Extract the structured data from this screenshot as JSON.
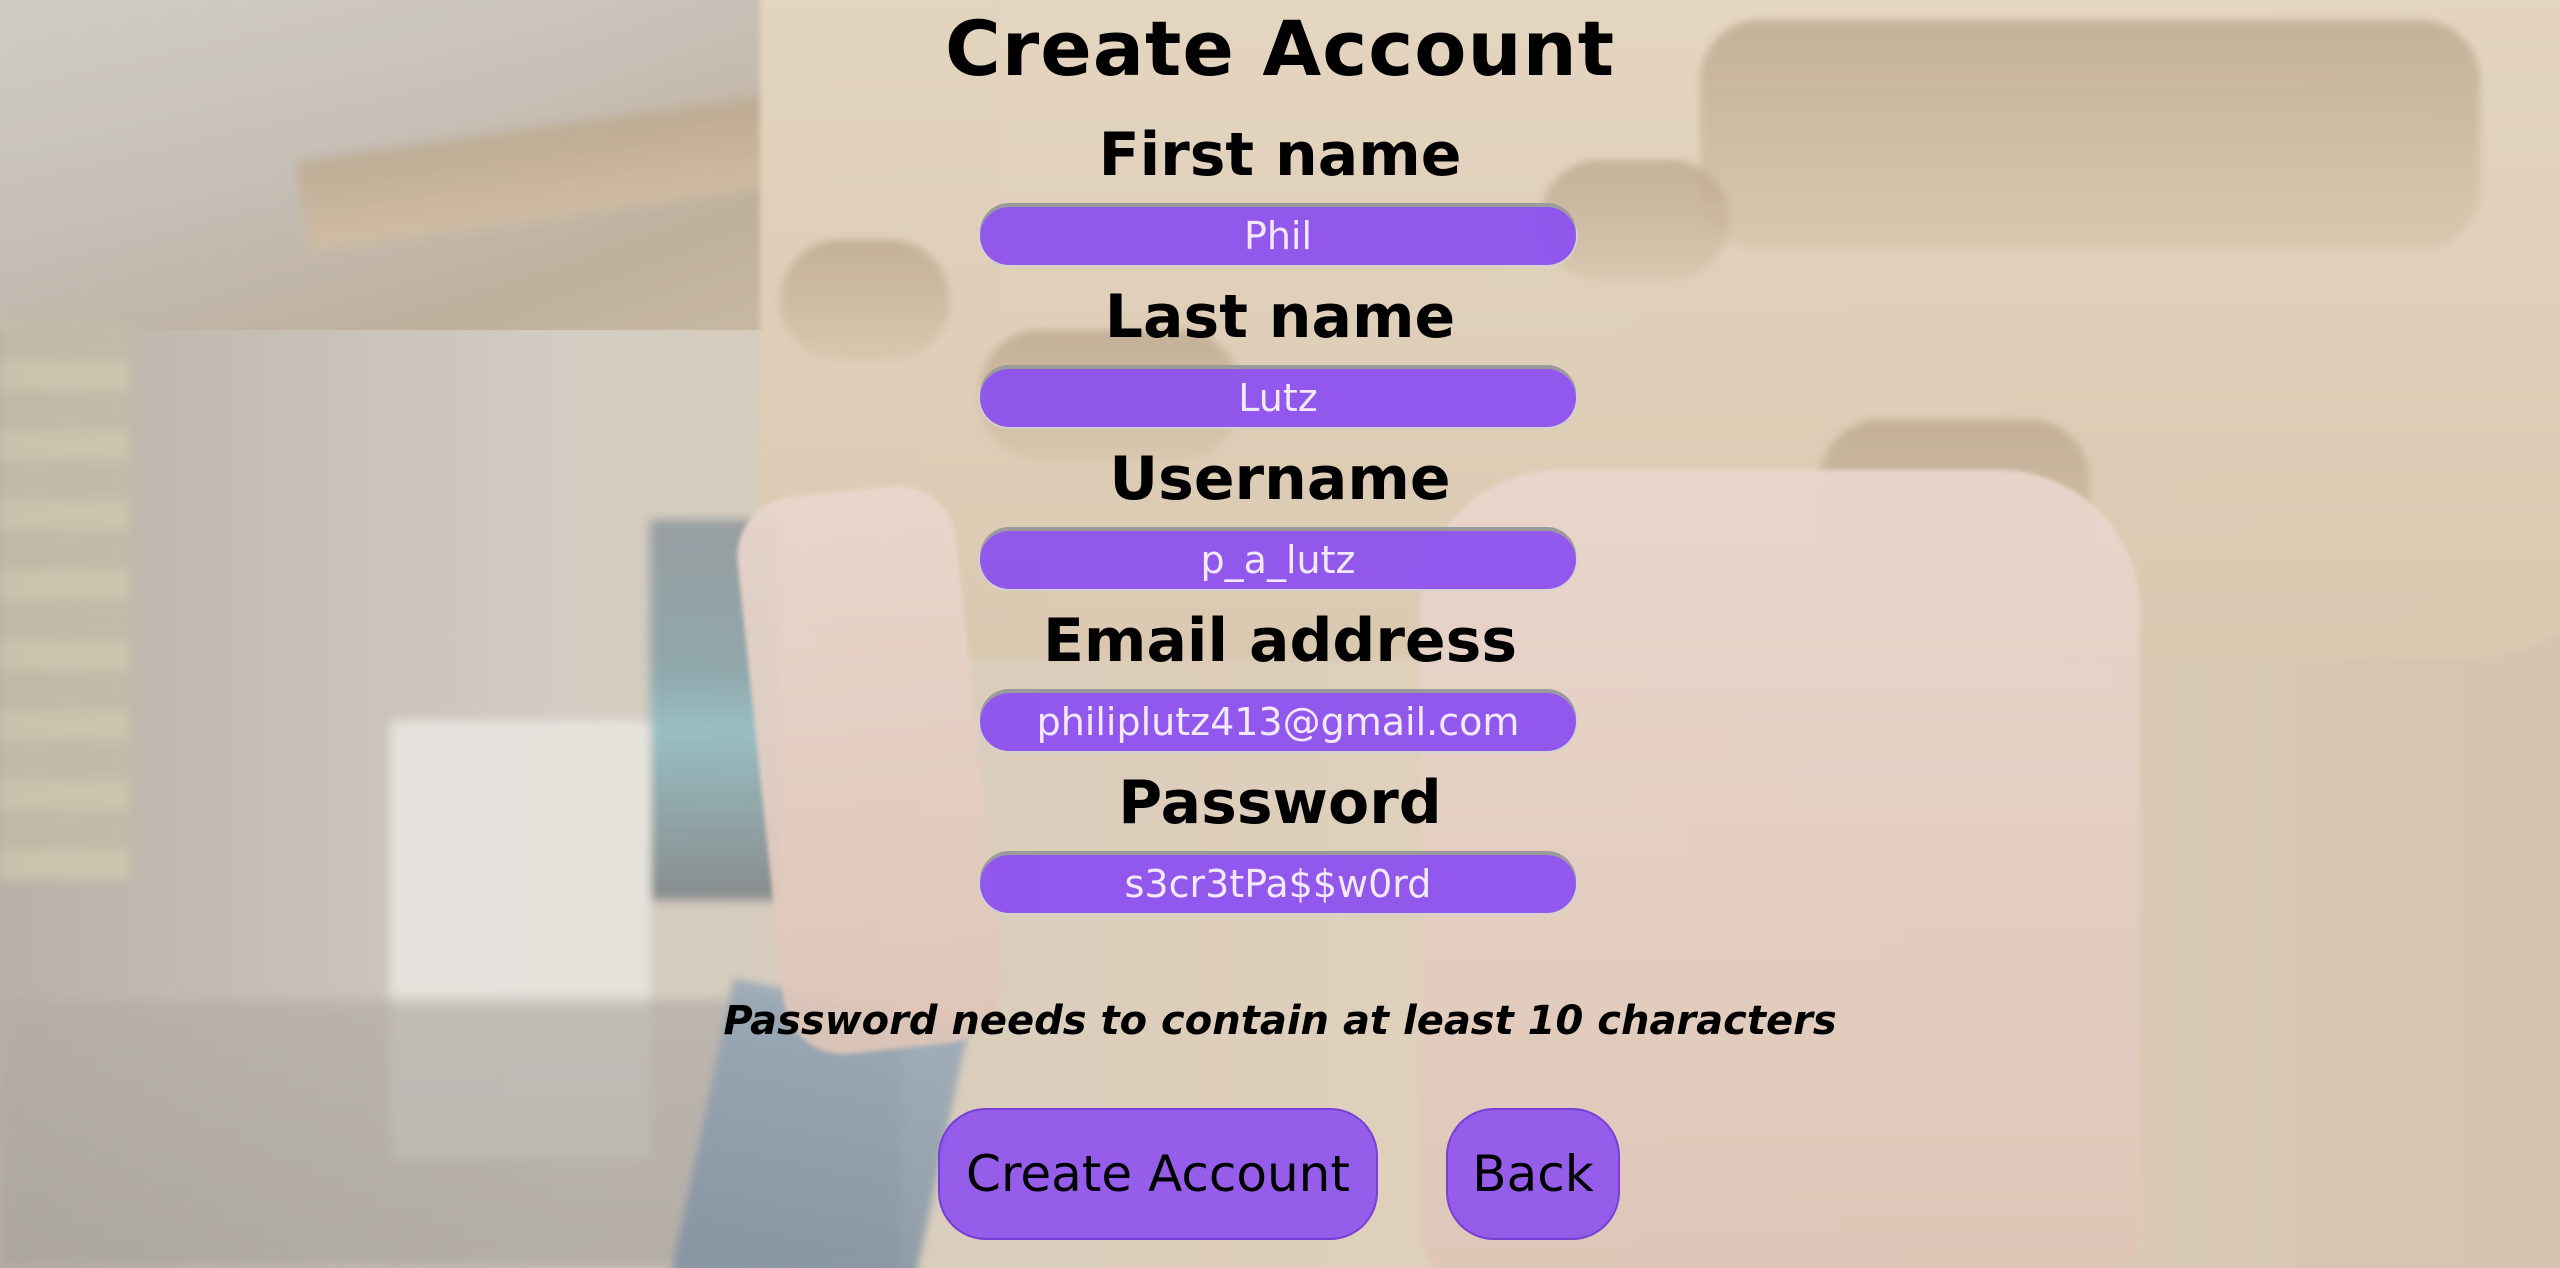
{
  "page": {
    "title": "Create Account"
  },
  "fields": [
    {
      "label": "First name",
      "value": "Phil"
    },
    {
      "label": "Last name",
      "value": "Lutz"
    },
    {
      "label": "Username",
      "value": "p_a_lutz"
    },
    {
      "label": "Email address",
      "value": "philiplutz413@gmail.com"
    },
    {
      "label": "Password",
      "value": "s3cr3tPa$$w0rd"
    }
  ],
  "hint": "Password needs to contain at least 10 characters",
  "buttons": {
    "create": "Create Account",
    "back": "Back"
  },
  "colors": {
    "accent": "#8b4df0",
    "input_text": "#f2e9ff",
    "text": "#000000"
  }
}
